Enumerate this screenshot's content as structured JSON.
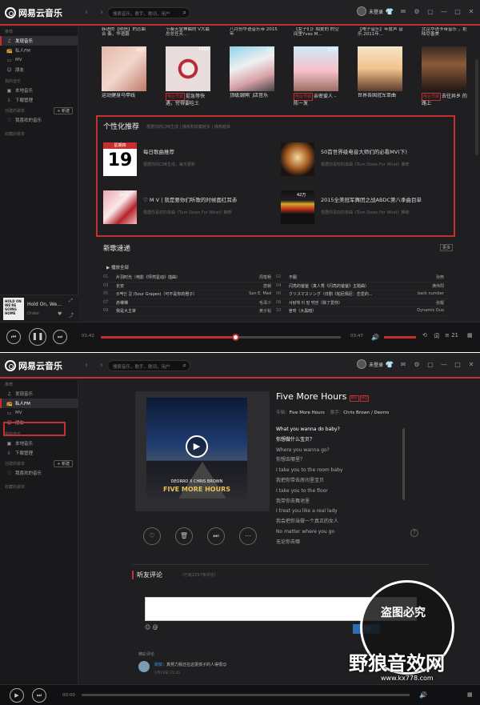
{
  "app": {
    "name": "网易云音乐",
    "search_placeholder": "搜索音乐，歌手，歌词，用户",
    "user": "未登录"
  },
  "sidebar": {
    "section_recommend": "推荐",
    "items": [
      {
        "label": "发现音乐",
        "icon": "music-note-icon"
      },
      {
        "label": "私人FM",
        "icon": "radio-icon"
      },
      {
        "label": "MV",
        "icon": "video-icon"
      },
      {
        "label": "朋友",
        "icon": "friends-icon"
      }
    ],
    "section_my_music": "我的音乐",
    "my_items": [
      {
        "label": "本地音乐",
        "icon": "computer-icon"
      },
      {
        "label": "下载管理",
        "icon": "download-icon"
      }
    ],
    "section_created": "创建的歌单",
    "new_label": "+ 新建",
    "created_items": [
      {
        "label": "我喜欢的音乐",
        "icon": "heart-icon"
      }
    ],
    "section_collected": "收藏的歌单"
  },
  "now_playing": {
    "title": "Hold On, We...",
    "artist": "Drake",
    "cover_text": "HOLD ON WE'RE GOING HOME"
  },
  "window1": {
    "covers": [
      {
        "top": "韩语的【明信】的恋曲合\n奏，华语篇",
        "count": "28万",
        "caption": "运动健身马甲线"
      },
      {
        "top": "节奏天堂神曲的\nV大最总总任天...",
        "count": "5665",
        "caption_tag": "电台节目",
        "caption": "捉急等快\n遇，穷得要吃土"
      },
      {
        "top": "八月份华语音乐带\n2015年",
        "count": "1万",
        "caption": "顶级潮牌门店音乐"
      },
      {
        "top": "《女子们》相爱的\n的空间里Yves M...",
        "count": "17万",
        "caption_tag": "电台节目",
        "caption": "亲密爱人\n- 陈一发"
      },
      {
        "top": "【电子音乐】年度声\n音乐.2011年...",
        "count": "",
        "caption": "世界各国冠军单曲"
      },
      {
        "top": "北京华语卡帝音乐\n，拒陆尽善美",
        "count": "",
        "caption_tag": "电台节目",
        "caption": "去往异乡\n的路上"
      }
    ],
    "personal": {
      "title": "个性化推荐",
      "tabs": "根据你的口味生成 | 播放和收藏越多 | 推荐越准",
      "items": [
        {
          "kind": "calendar",
          "weekday": "星期四",
          "day": "19",
          "title": "每日歌曲推荐",
          "sub": "根据你的口味生成，每天更新"
        },
        {
          "kind": "image",
          "count": "",
          "title": "50首世界级电音大师们的必看MV(下)",
          "sub": "根据你喜欢的单曲《Turn Down For What》推荐"
        },
        {
          "kind": "image",
          "count": "24万",
          "title": "♡ M V | 就是要你们听歌的时候面红耳赤",
          "sub": "根据你喜欢的单曲《Turn Down For What》推荐"
        },
        {
          "kind": "image",
          "count": "42万",
          "title": "2015全美冠军舞团之战ABDC第八季曲目单",
          "sub": "根据你喜欢的单曲《Turn Down For What》推荐"
        }
      ]
    },
    "new_songs": {
      "title": "新歌速递",
      "more": "更多",
      "play_all": "播放全部",
      "rows": [
        [
          {
            "n": "01",
            "t": "片羽时光（电影《怦然星动》插曲）",
            "a": "周笔畅"
          },
          {
            "n": "02",
            "t": "不服",
            "a": "孙燕"
          }
        ],
        [
          {
            "n": "03",
            "t": "长安",
            "a": "唐朝"
          },
          {
            "n": "04",
            "t": "闪亮的爸爸（真人秀《闪亮的爸爸》主题曲）",
            "a": "满伟阳"
          }
        ],
        [
          {
            "n": "05",
            "t": "쏘맥인 걸 (Sour Grapes)（可不是你的橙子）",
            "a": "San E, Mad"
          },
          {
            "n": "06",
            "t": "クリスマスソング（日剧《帕尼佩尼：恋爱的...",
            "a": "back number"
          }
        ],
        [
          {
            "n": "07",
            "t": "赤裸裸",
            "a": "毛泽少"
          },
          {
            "n": "08",
            "t": "사랑해 이 말 밖엔（除了爱你）",
            "a": "张靓"
          }
        ],
        [
          {
            "n": "09",
            "t": "我是大主宰",
            "a": "黄子韬"
          },
          {
            "n": "10",
            "t": "블랙（大黑暗）",
            "a": "Dynamic Duo"
          }
        ]
      ]
    },
    "player": {
      "elapsed": "01:42",
      "total": "03:47",
      "progress": 0.56,
      "count": "21"
    }
  },
  "window2": {
    "song": {
      "title": "Five More Hours",
      "album_label": "专辑：",
      "album": "Five More Hours",
      "artist_label": "歌手：",
      "artist": "Chris Brown / Deorro"
    },
    "album_art": {
      "artists": "DEORRO X CHRIS BROWN",
      "title": "FIVE MORE HOURS"
    },
    "lyrics": [
      "What you wanna do baby?",
      "你想做什么宝贝？",
      "Where you wanna go?",
      "你想去哪里？",
      "I take you to the room baby",
      "我把你带去房间里宝贝",
      "I take you to the floor",
      "我带你去舞池里",
      "I treat you like a real lady",
      "我会把你当做一个真正的女人",
      "No matter where you go",
      "无论你去哪"
    ],
    "comments": {
      "title": "听友评论",
      "count": "（已有2257条评论）",
      "submit": "评论",
      "hot_label": "精彩评论",
      "first_user": "朝葵",
      "first_text": "真努力我还在这耍孩子的人得很😊",
      "first_time": "1月19日 21:35"
    },
    "player": {
      "elapsed": "00:00",
      "total": "",
      "progress": 0.0
    }
  },
  "watermark": {
    "line1": "盗图必究",
    "line2": "野狼音效网",
    "line3": "www.kx778.com"
  },
  "colors": {
    "accent": "#c62f2f",
    "bg": "#1f1f22"
  }
}
